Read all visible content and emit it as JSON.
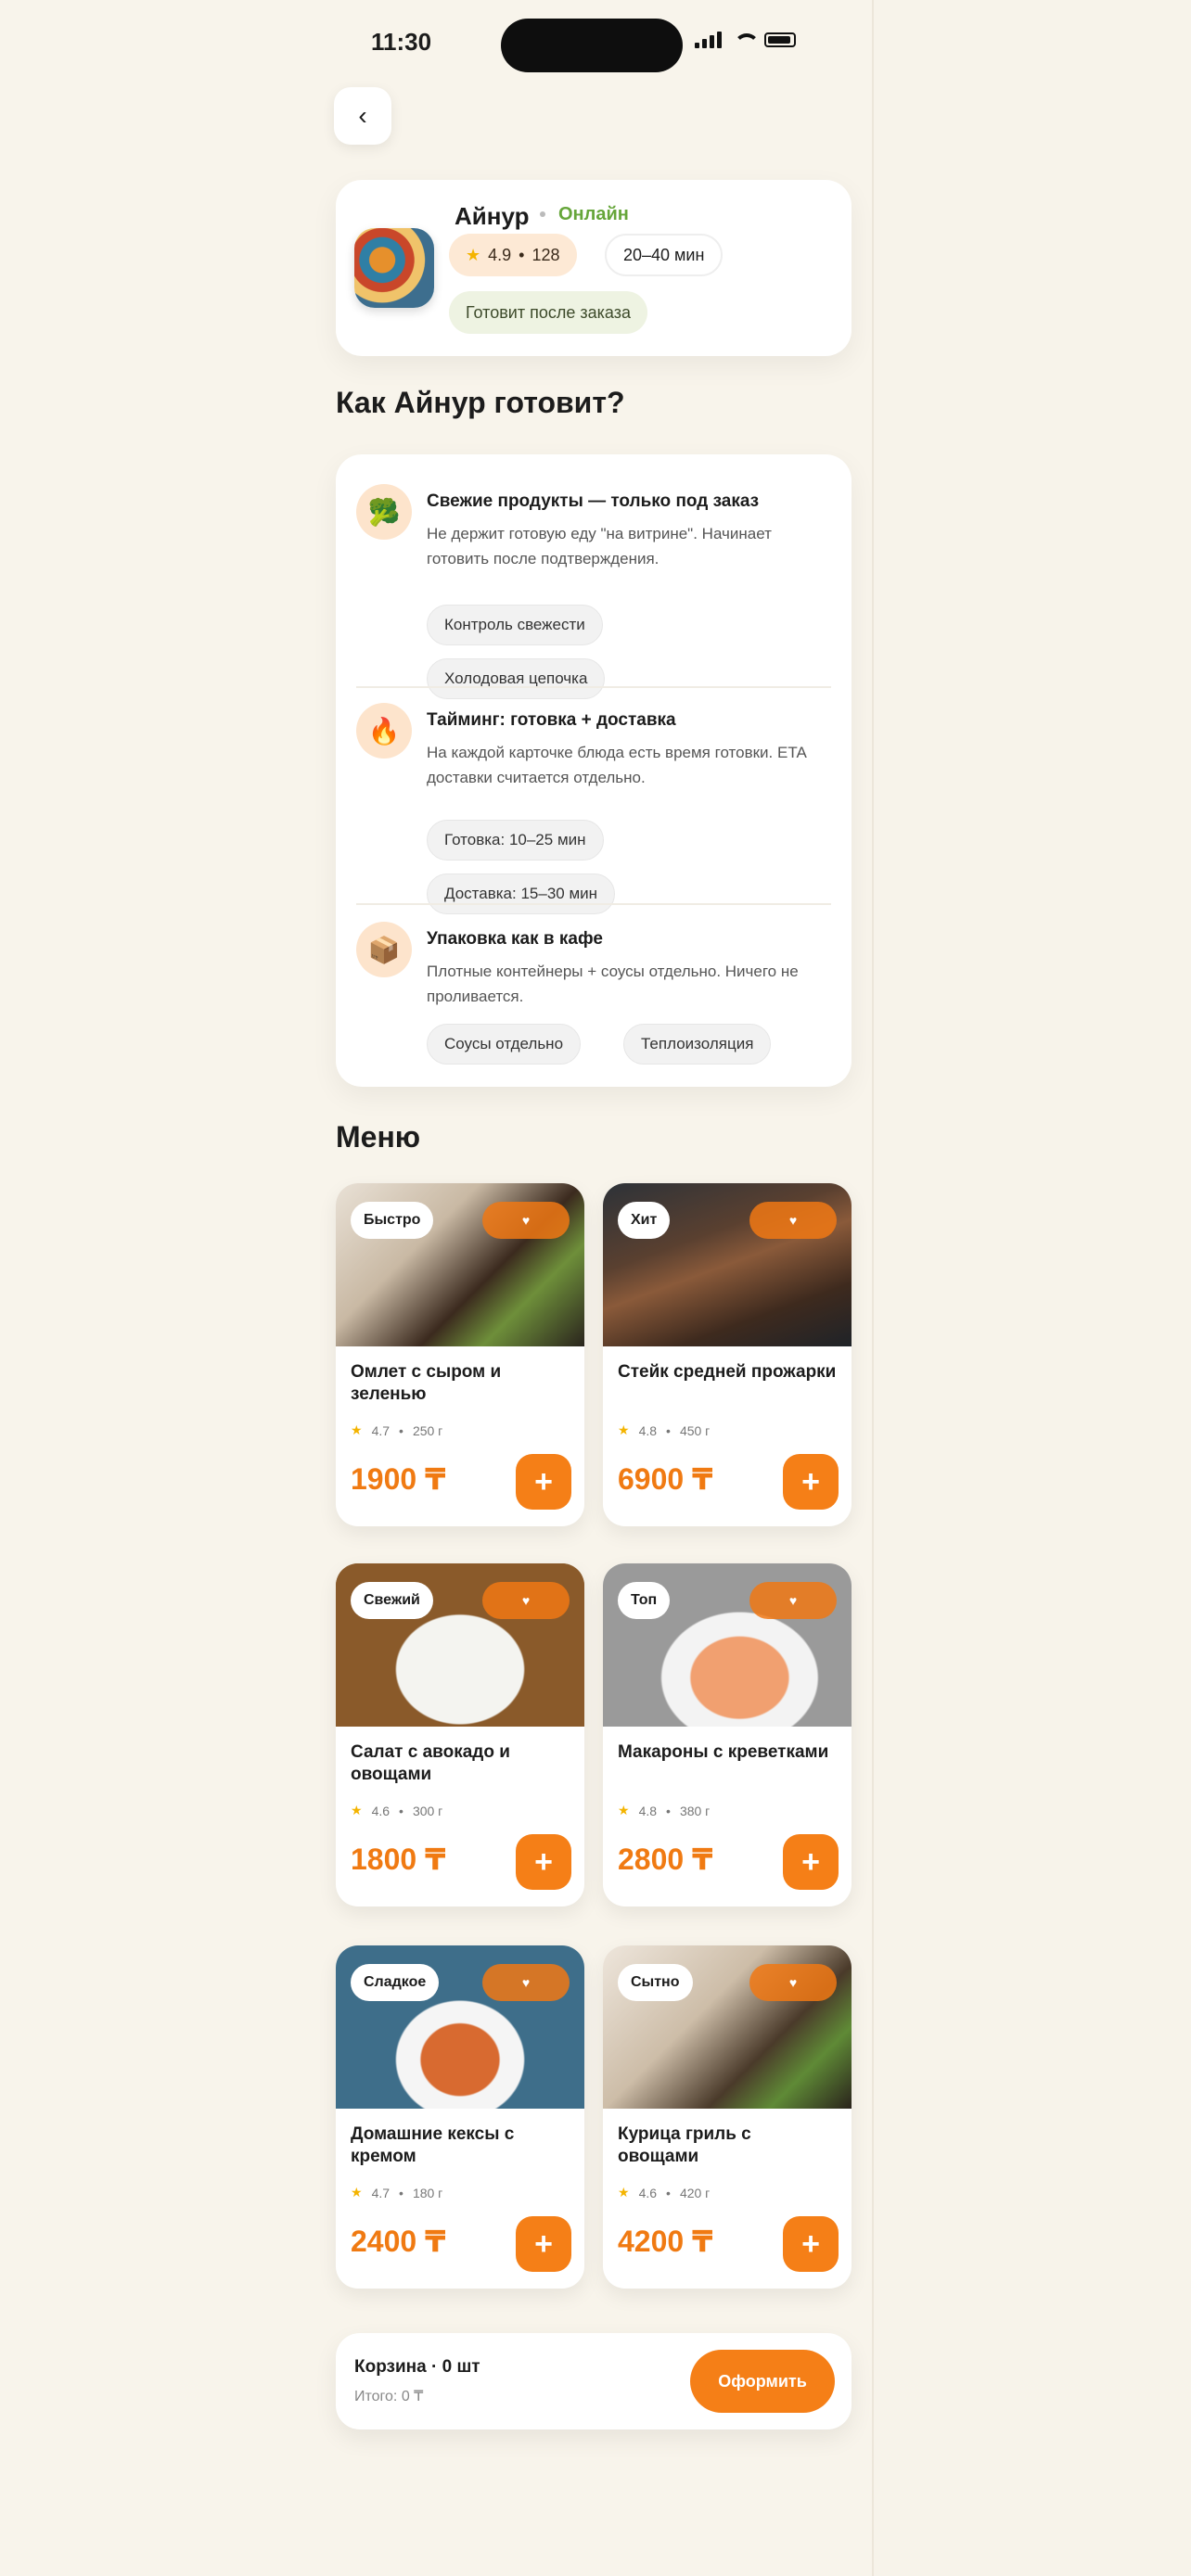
{
  "status_bar": {
    "time": "11:30"
  },
  "profile": {
    "name": "Айнур",
    "status": "Онлайн",
    "rating": "4.9",
    "reviews": "128",
    "delivery_time": "20–40 мин",
    "order_note": "Готовит после заказа"
  },
  "how_section": {
    "title": "Как Айнур готовит?",
    "items": [
      {
        "title": "Свежие продукты — только под заказ",
        "desc": "Не держит готовую еду \"на витрине\". Начинает готовить после подтверждения.",
        "tags": [
          "Контроль свежести",
          "Холодовая цепочка"
        ]
      },
      {
        "title": "Тайминг: готовка + доставка",
        "desc": "На каждой карточке блюда есть время готовки. ETA доставки считается отдельно.",
        "tags": [
          "Готовка: 10–25 мин",
          "Доставка: 15–30 мин"
        ]
      },
      {
        "title": "Упаковка как в кафе",
        "desc": "Плотные контейнеры + соусы отдельно. Ничего не проливается.",
        "tags": [
          "Соусы отдельно",
          "Теплоизоляция"
        ]
      }
    ]
  },
  "menu": {
    "title": "Меню",
    "items": [
      {
        "badge": "Быстро",
        "name": "Омлет с сыром и зеленью",
        "rating": "4.7",
        "weight": "250 г",
        "price": "1900 ₸"
      },
      {
        "badge": "Хит",
        "name": "Стейк средней прожарки",
        "rating": "4.8",
        "weight": "450 г",
        "price": "6900 ₸"
      },
      {
        "badge": "Свежий",
        "name": "Салат с авокадо и овощами",
        "rating": "4.6",
        "weight": "300 г",
        "price": "1800 ₸"
      },
      {
        "badge": "Топ",
        "name": "Макароны с креветками",
        "rating": "4.8",
        "weight": "380 г",
        "price": "2800 ₸"
      },
      {
        "badge": "Сладкое",
        "name": "Домашние кексы с кремом",
        "rating": "4.7",
        "weight": "180 г",
        "price": "2400 ₸"
      },
      {
        "badge": "Сытно",
        "name": "Курица гриль с овощами",
        "rating": "4.6",
        "weight": "420 г",
        "price": "4200 ₸"
      }
    ]
  },
  "cart": {
    "title": "Корзина · 0 шт",
    "subtitle": "Итого: 0 ₸",
    "checkout_label": "Оформить"
  }
}
